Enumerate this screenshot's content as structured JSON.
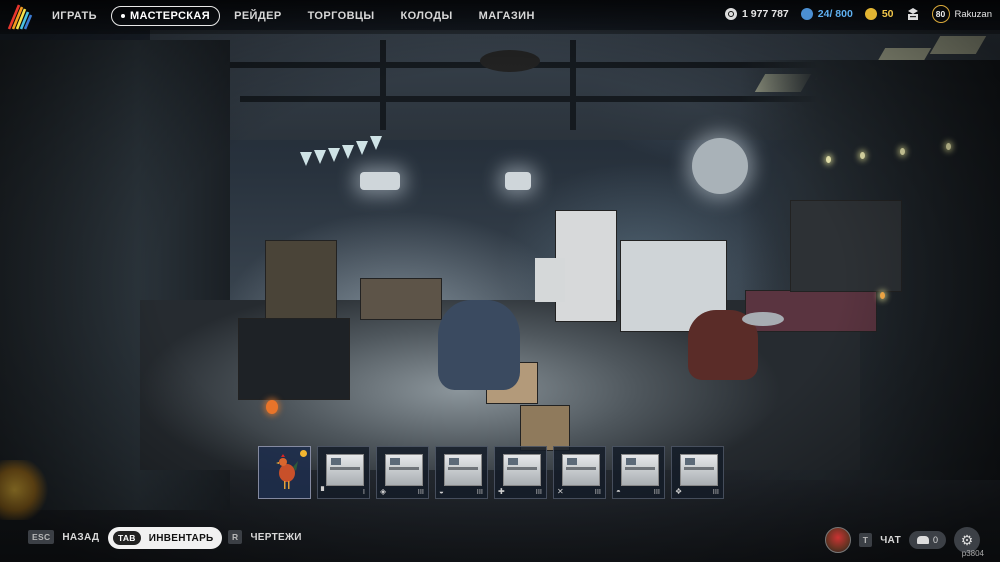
{
  "topbar": {
    "nav": [
      {
        "label": "ИГРАТЬ",
        "active": false
      },
      {
        "label": "МАСТЕРСКАЯ",
        "active": true
      },
      {
        "label": "РЕЙДЕР",
        "active": false
      },
      {
        "label": "ТОРГОВЦЫ",
        "active": false
      },
      {
        "label": "КОЛОДЫ",
        "active": false
      },
      {
        "label": "МАГАЗИН",
        "active": false
      }
    ],
    "coins": "1 977 787",
    "storage": "24/ 800",
    "gold": "50",
    "level": "80",
    "username": "Rakuzan"
  },
  "hotbar": [
    {
      "icon": "rooster-icon",
      "count": ""
    },
    {
      "glyph": "▘",
      "count": "I"
    },
    {
      "glyph": "◈",
      "count": "III"
    },
    {
      "glyph": "◒",
      "count": "III"
    },
    {
      "glyph": "✚",
      "count": "III"
    },
    {
      "glyph": "✕",
      "count": "III"
    },
    {
      "glyph": "◓",
      "count": "III"
    },
    {
      "glyph": "❖",
      "count": "III"
    }
  ],
  "bottombar": {
    "back_key": "ESC",
    "back_label": "НАЗАД",
    "inventory_key": "TAB",
    "inventory_label": "ИНВЕНТАРЬ",
    "blueprints_key": "R",
    "blueprints_label": "ЧЕРТЕЖИ",
    "chat_key": "T",
    "chat_label": "ЧАТ",
    "friends_count": "0"
  },
  "build_id": "p3804",
  "colors": {
    "storage": "#5fb0f0",
    "gold": "#f1c64a",
    "accent": "#d9a93a"
  }
}
